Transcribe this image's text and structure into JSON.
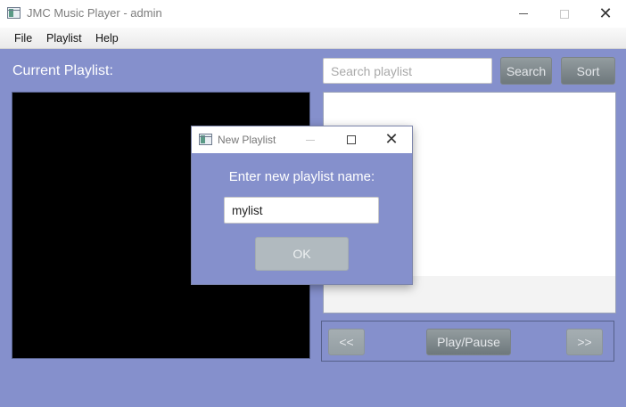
{
  "window": {
    "title": "JMC Music Player - admin"
  },
  "menu": {
    "items": [
      "File",
      "Playlist",
      "Help"
    ]
  },
  "main": {
    "current_playlist_label": "Current Playlist:",
    "search": {
      "placeholder": "Search playlist",
      "value": ""
    },
    "search_button": "Search",
    "sort_button": "Sort"
  },
  "controls": {
    "prev_label": "<<",
    "play_pause_label": "Play/Pause",
    "next_label": ">>"
  },
  "dialog": {
    "title": "New Playlist",
    "prompt": "Enter new playlist name:",
    "input_value": "mylist",
    "ok_label": "OK"
  },
  "colors": {
    "background": "#8590cc",
    "button": "#7f898d",
    "video": "#000000"
  }
}
